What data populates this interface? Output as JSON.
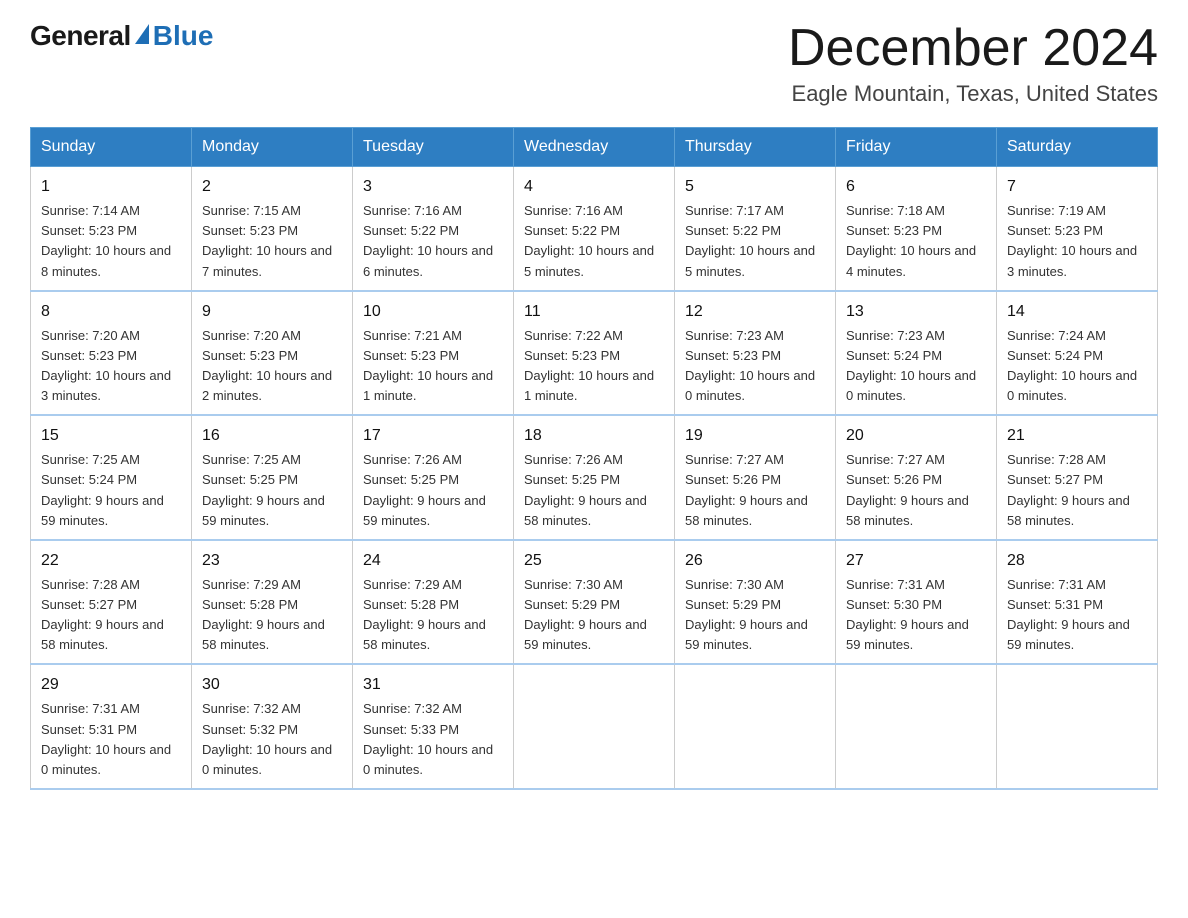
{
  "header": {
    "logo_general": "General",
    "logo_blue": "Blue",
    "month_title": "December 2024",
    "location": "Eagle Mountain, Texas, United States"
  },
  "days_of_week": [
    "Sunday",
    "Monday",
    "Tuesday",
    "Wednesday",
    "Thursday",
    "Friday",
    "Saturday"
  ],
  "weeks": [
    [
      {
        "day": "1",
        "sunrise": "7:14 AM",
        "sunset": "5:23 PM",
        "daylight": "10 hours and 8 minutes."
      },
      {
        "day": "2",
        "sunrise": "7:15 AM",
        "sunset": "5:23 PM",
        "daylight": "10 hours and 7 minutes."
      },
      {
        "day": "3",
        "sunrise": "7:16 AM",
        "sunset": "5:22 PM",
        "daylight": "10 hours and 6 minutes."
      },
      {
        "day": "4",
        "sunrise": "7:16 AM",
        "sunset": "5:22 PM",
        "daylight": "10 hours and 5 minutes."
      },
      {
        "day": "5",
        "sunrise": "7:17 AM",
        "sunset": "5:22 PM",
        "daylight": "10 hours and 5 minutes."
      },
      {
        "day": "6",
        "sunrise": "7:18 AM",
        "sunset": "5:23 PM",
        "daylight": "10 hours and 4 minutes."
      },
      {
        "day": "7",
        "sunrise": "7:19 AM",
        "sunset": "5:23 PM",
        "daylight": "10 hours and 3 minutes."
      }
    ],
    [
      {
        "day": "8",
        "sunrise": "7:20 AM",
        "sunset": "5:23 PM",
        "daylight": "10 hours and 3 minutes."
      },
      {
        "day": "9",
        "sunrise": "7:20 AM",
        "sunset": "5:23 PM",
        "daylight": "10 hours and 2 minutes."
      },
      {
        "day": "10",
        "sunrise": "7:21 AM",
        "sunset": "5:23 PM",
        "daylight": "10 hours and 1 minute."
      },
      {
        "day": "11",
        "sunrise": "7:22 AM",
        "sunset": "5:23 PM",
        "daylight": "10 hours and 1 minute."
      },
      {
        "day": "12",
        "sunrise": "7:23 AM",
        "sunset": "5:23 PM",
        "daylight": "10 hours and 0 minutes."
      },
      {
        "day": "13",
        "sunrise": "7:23 AM",
        "sunset": "5:24 PM",
        "daylight": "10 hours and 0 minutes."
      },
      {
        "day": "14",
        "sunrise": "7:24 AM",
        "sunset": "5:24 PM",
        "daylight": "10 hours and 0 minutes."
      }
    ],
    [
      {
        "day": "15",
        "sunrise": "7:25 AM",
        "sunset": "5:24 PM",
        "daylight": "9 hours and 59 minutes."
      },
      {
        "day": "16",
        "sunrise": "7:25 AM",
        "sunset": "5:25 PM",
        "daylight": "9 hours and 59 minutes."
      },
      {
        "day": "17",
        "sunrise": "7:26 AM",
        "sunset": "5:25 PM",
        "daylight": "9 hours and 59 minutes."
      },
      {
        "day": "18",
        "sunrise": "7:26 AM",
        "sunset": "5:25 PM",
        "daylight": "9 hours and 58 minutes."
      },
      {
        "day": "19",
        "sunrise": "7:27 AM",
        "sunset": "5:26 PM",
        "daylight": "9 hours and 58 minutes."
      },
      {
        "day": "20",
        "sunrise": "7:27 AM",
        "sunset": "5:26 PM",
        "daylight": "9 hours and 58 minutes."
      },
      {
        "day": "21",
        "sunrise": "7:28 AM",
        "sunset": "5:27 PM",
        "daylight": "9 hours and 58 minutes."
      }
    ],
    [
      {
        "day": "22",
        "sunrise": "7:28 AM",
        "sunset": "5:27 PM",
        "daylight": "9 hours and 58 minutes."
      },
      {
        "day": "23",
        "sunrise": "7:29 AM",
        "sunset": "5:28 PM",
        "daylight": "9 hours and 58 minutes."
      },
      {
        "day": "24",
        "sunrise": "7:29 AM",
        "sunset": "5:28 PM",
        "daylight": "9 hours and 58 minutes."
      },
      {
        "day": "25",
        "sunrise": "7:30 AM",
        "sunset": "5:29 PM",
        "daylight": "9 hours and 59 minutes."
      },
      {
        "day": "26",
        "sunrise": "7:30 AM",
        "sunset": "5:29 PM",
        "daylight": "9 hours and 59 minutes."
      },
      {
        "day": "27",
        "sunrise": "7:31 AM",
        "sunset": "5:30 PM",
        "daylight": "9 hours and 59 minutes."
      },
      {
        "day": "28",
        "sunrise": "7:31 AM",
        "sunset": "5:31 PM",
        "daylight": "9 hours and 59 minutes."
      }
    ],
    [
      {
        "day": "29",
        "sunrise": "7:31 AM",
        "sunset": "5:31 PM",
        "daylight": "10 hours and 0 minutes."
      },
      {
        "day": "30",
        "sunrise": "7:32 AM",
        "sunset": "5:32 PM",
        "daylight": "10 hours and 0 minutes."
      },
      {
        "day": "31",
        "sunrise": "7:32 AM",
        "sunset": "5:33 PM",
        "daylight": "10 hours and 0 minutes."
      },
      null,
      null,
      null,
      null
    ]
  ],
  "labels": {
    "sunrise": "Sunrise:",
    "sunset": "Sunset:",
    "daylight": "Daylight:"
  }
}
